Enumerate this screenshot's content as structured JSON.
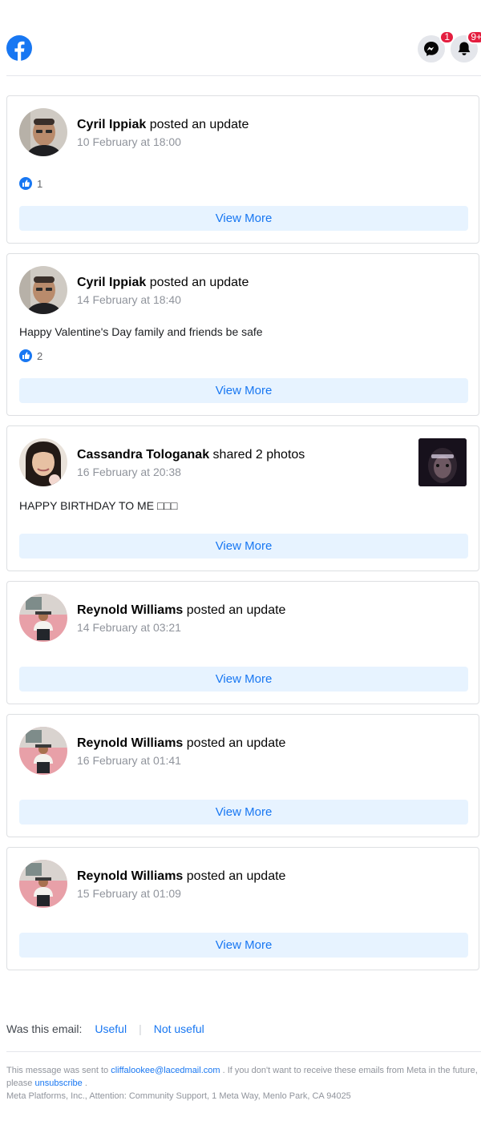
{
  "header": {
    "messenger_badge": "1",
    "notifications_badge": "9+",
    "brand_color": "#1877f2"
  },
  "cards": [
    {
      "author": "Cyril Ippiak",
      "action": "posted an update",
      "time": "10 February at 18:00",
      "text": "",
      "likes": "1",
      "button": "View More"
    },
    {
      "author": "Cyril Ippiak",
      "action": "posted an update",
      "time": "14 February at 18:40",
      "text": "Happy Valentine's Day family and friends be safe",
      "likes": "2",
      "button": "View More"
    },
    {
      "author": "Cassandra Tologanak",
      "action": "shared 2 photos",
      "time": "16 February at 20:38",
      "text": "HAPPY BIRTHDAY TO ME □□□",
      "button": "View More"
    },
    {
      "author": "Reynold Williams",
      "action": "posted an update",
      "time": "14 February at 03:21",
      "button": "View More"
    },
    {
      "author": "Reynold Williams",
      "action": "posted an update",
      "time": "16 February at 01:41",
      "button": "View More"
    },
    {
      "author": "Reynold Williams",
      "action": "posted an update",
      "time": "15 February at 01:09",
      "button": "View More"
    }
  ],
  "feedback": {
    "prompt": "Was this email:",
    "useful": "Useful",
    "separator": "|",
    "not_useful": "Not useful"
  },
  "footer": {
    "sent_to_prefix": "This message was sent to",
    "email": "cliffalookee@lacedmail.com",
    "sent_to_suffix": ". If you don't want to receive these emails from Meta in the future, please",
    "unsubscribe": "unsubscribe",
    "period": ".",
    "address": "Meta Platforms, Inc., Attention: Community Support, 1 Meta Way, Menlo Park, CA 94025"
  }
}
